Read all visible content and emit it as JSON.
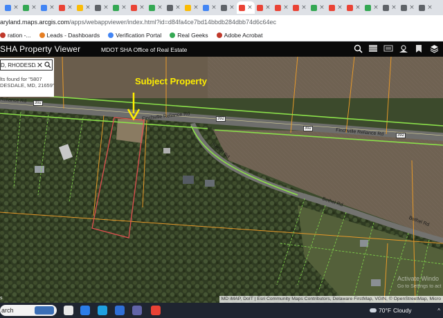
{
  "browser": {
    "tabs": [
      {
        "letter": "G",
        "color": "#4285f4"
      },
      {
        "letter": "",
        "color": "#34a853"
      },
      {
        "letter": "",
        "color": "#4285f4"
      },
      {
        "letter": "",
        "color": "#ea4335"
      },
      {
        "letter": "",
        "color": "#fbbc05"
      },
      {
        "letter": "",
        "color": "#5f6368"
      },
      {
        "letter": "",
        "color": "#34a853"
      },
      {
        "letter": "",
        "color": "#ea4335"
      },
      {
        "letter": "",
        "color": "#34a853"
      },
      {
        "letter": "",
        "color": "#5f6368"
      },
      {
        "letter": "",
        "color": "#fbbc05"
      },
      {
        "letter": "",
        "color": "#4285f4"
      },
      {
        "letter": "",
        "color": "#5f6368"
      },
      {
        "letter": "",
        "color": "#ea4335"
      },
      {
        "letter": "",
        "color": "#ea4335"
      },
      {
        "letter": "",
        "color": "#ea4335"
      },
      {
        "letter": "",
        "color": "#ea4335"
      },
      {
        "letter": "",
        "color": "#34a853"
      },
      {
        "letter": "",
        "color": "#ea4335"
      },
      {
        "letter": "",
        "color": "#ea4335"
      },
      {
        "letter": "",
        "color": "#34a853"
      },
      {
        "letter": "",
        "color": "#5f6368"
      },
      {
        "letter": "",
        "color": "#5f6368"
      },
      {
        "letter": "",
        "color": "#5f6368"
      }
    ],
    "url_prefix": "aryland.maps.arcgis.com",
    "url_rest": "/apps/webappviewer/index.html?id=d84fa4ce7bd14bbdb284dbb74d6c64ec",
    "bookmarks": [
      {
        "label": "ration -...",
        "color": "#c0392b"
      },
      {
        "label": "Leads - Dashboards",
        "color": "#e67e22"
      },
      {
        "label": "Verification Portal",
        "color": "#4285f4"
      },
      {
        "label": "Real Geeks",
        "color": "#34a853"
      },
      {
        "label": "Adobe Acrobat",
        "color": "#c0392b"
      }
    ]
  },
  "app": {
    "title": "SHA Property Viewer",
    "subtitle": "MDOT SHA Office of Real Estate",
    "tools": [
      "zoom-icon",
      "table-icon",
      "layers-list-icon",
      "basemap-icon",
      "bookmark-icon",
      "layers-icon"
    ]
  },
  "search": {
    "value": "D, RHODESDAI",
    "results_line1": "lts found for \"5807",
    "results_line2": "DESDALE, MD, 21659\"."
  },
  "map": {
    "annotation": "Subject Property",
    "road_labels": [
      {
        "text": "Finchville Reliance Rd"
      },
      {
        "text": "Finchville Reliance Rd"
      },
      {
        "text": "Bethel Rd"
      },
      {
        "text": "Bethel Rd"
      },
      {
        "text": "Bethel Rd"
      },
      {
        "text": "Reliance Rd"
      }
    ],
    "route_shields": [
      "392",
      "392",
      "392",
      "392"
    ],
    "attribution": "MD iMAP, DoIT | Esri Community Maps Contributors, Delaware FirstMap, VGIN, © OpenStreetMap, Micro",
    "scale_hint": "s",
    "watermark_line1": "Activate Windo",
    "watermark_line2": "Go to Settings to act"
  },
  "taskbar": {
    "search_label": "arch",
    "weather_temp": "70°F",
    "weather_desc": "Cloudy",
    "icons": [
      {
        "name": "task-view-icon",
        "color": "#e8e8e8"
      },
      {
        "name": "store-icon",
        "color": "#2b7de9"
      },
      {
        "name": "edge-icon",
        "color": "#1fa0e0"
      },
      {
        "name": "mail-icon",
        "color": "#2f6fd6"
      },
      {
        "name": "teams-icon",
        "color": "#6264a7"
      },
      {
        "name": "chrome-icon",
        "color": "#e94235"
      }
    ]
  }
}
